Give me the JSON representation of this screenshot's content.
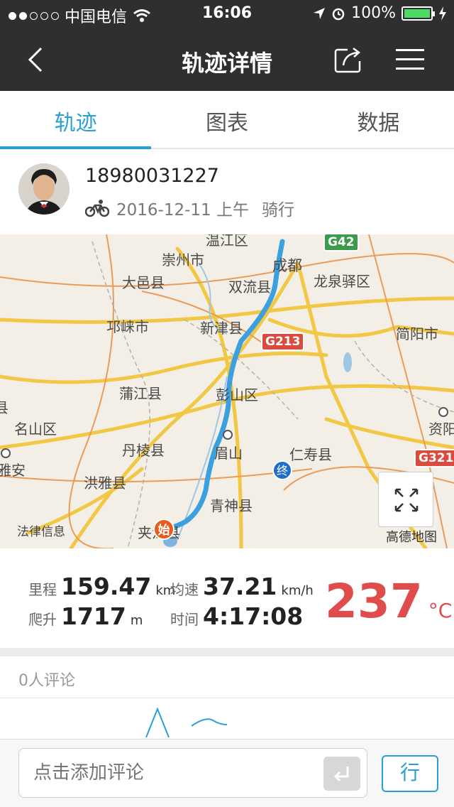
{
  "status_bar": {
    "carrier": "中国电信",
    "time": "16:06",
    "battery": "100%",
    "signal_bars_filled": 2,
    "signal_bars_total": 5
  },
  "nav": {
    "title": "轨迹详情",
    "icons": [
      "chevron-left-icon",
      "share-icon",
      "menu-icon"
    ]
  },
  "tabs": [
    {
      "label": "轨迹",
      "active": true
    },
    {
      "label": "图表",
      "active": false
    },
    {
      "label": "数据",
      "active": false
    }
  ],
  "user": {
    "name": "18980031227",
    "date": "2016-12-11 上午",
    "activity": "骑行",
    "activity_icon": "bicycle-icon"
  },
  "map": {
    "places": [
      "成都",
      "崇州市",
      "大邑县",
      "双流县",
      "龙泉驿区",
      "邛崃市",
      "新津县",
      "简阳市",
      "蒲江县",
      "彭山区",
      "名山区",
      "丹棱县",
      "眉山",
      "仁寿县",
      "资阳",
      "洪雅县",
      "青神县",
      "雅安",
      "夹江县"
    ],
    "highways": [
      "G42",
      "G213",
      "G321"
    ],
    "start_marker": "始",
    "end_marker": "终",
    "legal": "法律信息",
    "credit": "高德地图"
  },
  "stats": {
    "distance": {
      "label": "里程",
      "value": "159.47",
      "unit": "km"
    },
    "avg_speed": {
      "label": "均速",
      "value": "37.21",
      "unit": "km/h"
    },
    "climb": {
      "label": "爬升",
      "value": "1717",
      "unit": "m"
    },
    "duration": {
      "label": "时间",
      "value": "4:17:08"
    },
    "temperature": {
      "value": "237",
      "unit": "°C"
    }
  },
  "comments": {
    "count_label": "0人评论",
    "input_placeholder": "点击添加评论",
    "mode_button": "行"
  },
  "colors": {
    "accent": "#2a9fd6",
    "topbar": "#2f2f2f",
    "temperature": "#e04b4b",
    "route": "#3aa0e0"
  }
}
